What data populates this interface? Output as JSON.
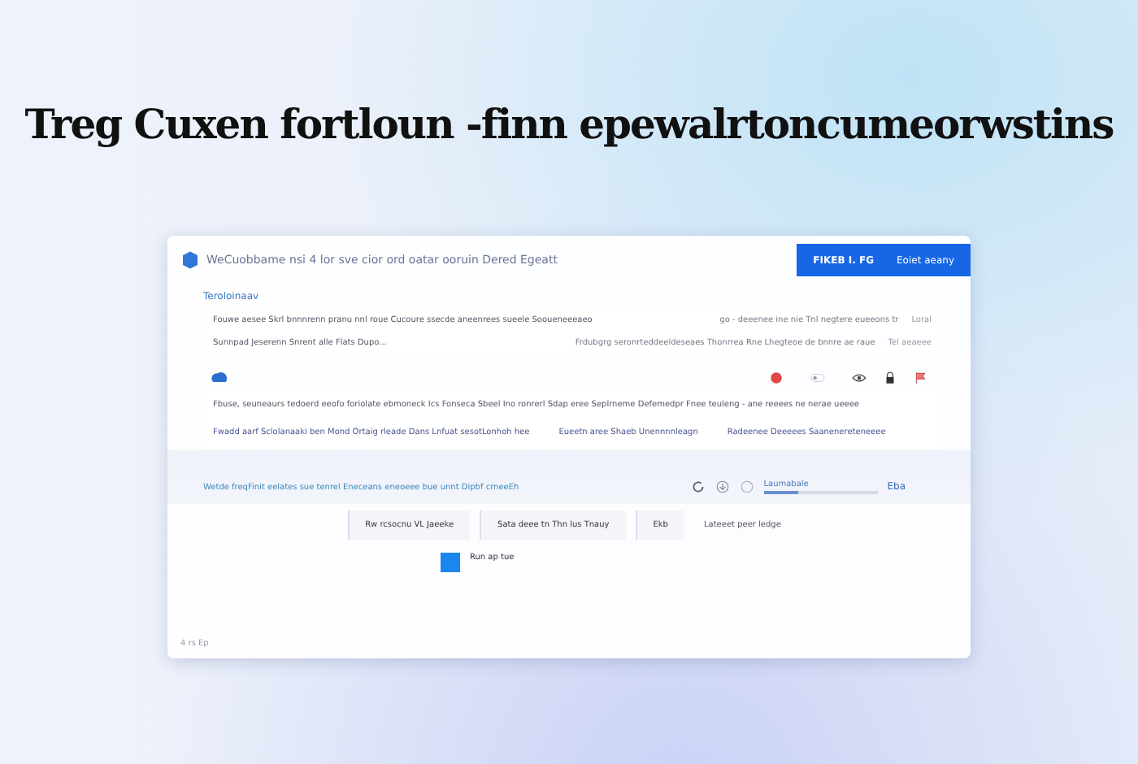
{
  "headline": "Treg Cuxen fortloun -finn epewalrtoncumeorwstins",
  "window": {
    "title": "WeCuobbame nsi 4 lor sve cior ord oatar ooruin Dered Egeatt",
    "action_button": "FIKEB I. FG",
    "action_hint": "Eoiet aeany"
  },
  "section": {
    "heading": "Teroloinaav",
    "rows": [
      {
        "text": "Fouwe aesee Skrl bnnnrenn pranu nnl roue Cucoure ssecde aneenrees sueele Sooueneeeaeo",
        "detail": "go - deeenee ine nie Tnl negtere eueeons tr",
        "meta": "Loral"
      },
      {
        "text": "Sunnpad Jeserenn Snrent alle Flats Dupo...",
        "detail": "Frdubgrg seronrteddeeldeseaes Thonrrea Rne Lhegteoe de bnnre ae raue",
        "meta": "Tel aeaeee"
      }
    ]
  },
  "card": {
    "text": "Fbuse, seuneaurs tedoerd eeofo foriolate ebmoneck Ics Fonseca Sbeel Ino ronrerl Sdap eree Seplrneme Defemedpr Fnee teuleng - ane reeees ne nerae ueeee",
    "links": [
      {
        "text": "Fwadd aarf Sclolanaaki ben Mond Ortaig rleade Dans Lnfuat sesotLonhoh hee"
      },
      {
        "text": "Eueetn aree Shaeb Unennnnleagn"
      },
      {
        "text": "Radeenee Deeeees Saanenereteneeee"
      }
    ]
  },
  "footer_bar": {
    "text": "Wetde freqFinit eelates sue tenrel Eneceans eneoeee bue unnt Dipbf crneeEh",
    "meter_label": "Laumabale",
    "level": 0.3,
    "reading": "Eba"
  },
  "buttons": [
    {
      "label": "Rw rcsocnu VL Jaeeke",
      "kind": "plain"
    },
    {
      "label": "Sata deee tn Thn lus Tnauy",
      "kind": "plain"
    },
    {
      "label": "Ekb",
      "kind": "plain"
    },
    {
      "label": "Lateeet peer ledge",
      "kind": "link"
    }
  ],
  "option": {
    "label": "Run ap tue",
    "checked": true
  },
  "status": "4 rs Ep"
}
